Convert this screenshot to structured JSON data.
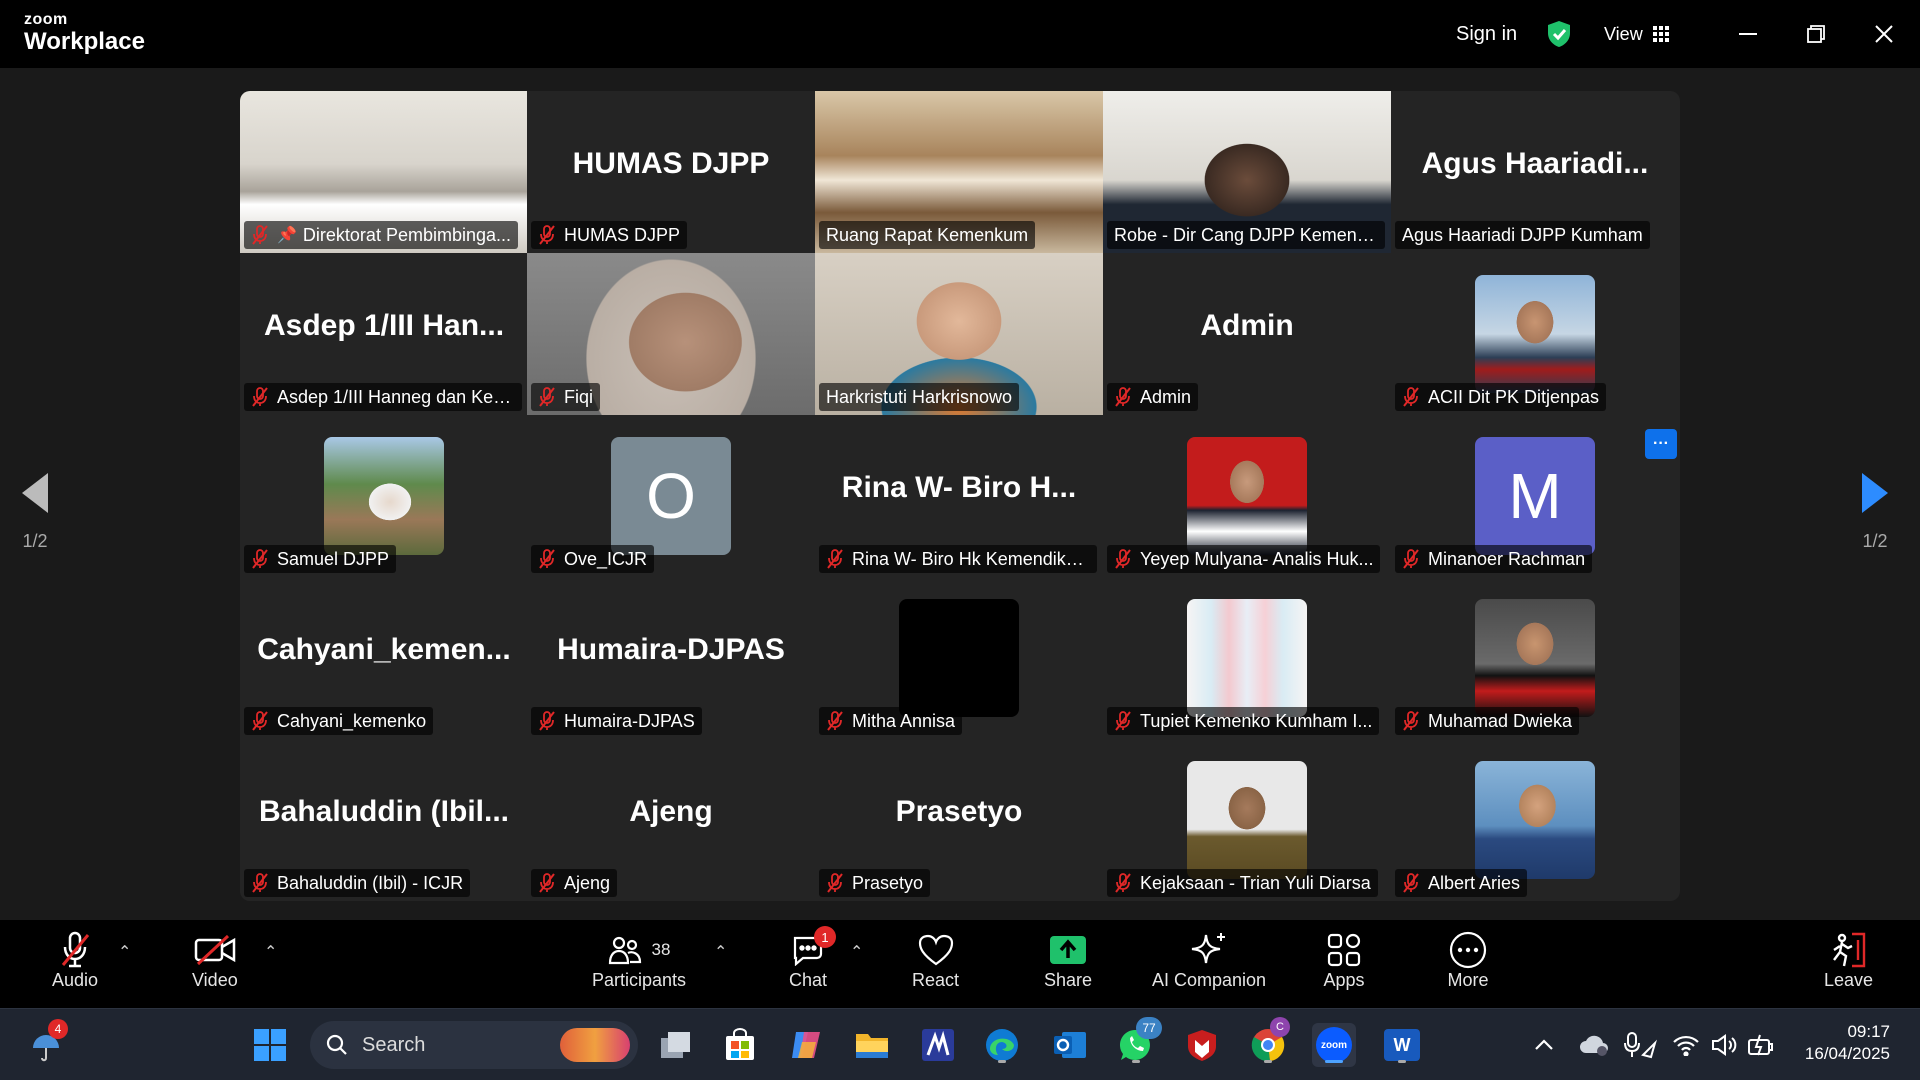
{
  "titlebar": {
    "brand_top": "zoom",
    "brand_bottom": "Workplace",
    "sign_in": "Sign in",
    "view_label": "View",
    "colors": {
      "shield": "#1fc16b"
    }
  },
  "pager": {
    "left": "1/2",
    "right": "1/2"
  },
  "tiles": [
    {
      "label": "Direktorat Pembimbinga...",
      "pinned": true,
      "muted": true,
      "type": "video",
      "scene": "meeting-room"
    },
    {
      "label": "HUMAS DJPP",
      "muted": true,
      "type": "name",
      "big_name": "HUMAS DJPP"
    },
    {
      "label": "Ruang Rapat Kemenkum",
      "muted": false,
      "type": "video",
      "scene": "conference-room"
    },
    {
      "label": "Robe - Dir Cang DJPP Kemenku...",
      "muted": false,
      "type": "video",
      "scene": "office-person",
      "active": true
    },
    {
      "label": "Agus Haariadi DJPP Kumham",
      "muted": false,
      "type": "name",
      "big_name": "Agus  Haariadi..."
    },
    {
      "label": "Asdep 1/III Hanneg dan Kes...",
      "muted": true,
      "type": "name",
      "big_name": "Asdep  1/III  Han..."
    },
    {
      "label": "Fiqi",
      "muted": true,
      "type": "video",
      "scene": "webcam-woman-hijab"
    },
    {
      "label": "Harkristuti Harkrisnowo",
      "muted": false,
      "type": "video",
      "scene": "webcam-woman"
    },
    {
      "label": "Admin",
      "muted": true,
      "type": "name",
      "big_name": "Admin"
    },
    {
      "label": "ACII Dit PK Ditjenpas",
      "muted": true,
      "type": "avatar",
      "avatar": "photo-man-suit"
    },
    {
      "label": "Samuel DJPP",
      "muted": true,
      "type": "avatar",
      "avatar": "photo-outdoor"
    },
    {
      "label": "Ove_ICJR",
      "muted": true,
      "type": "avatar",
      "initial": "O",
      "avatar_color": "#7a8a94"
    },
    {
      "label": "Rina W- Biro Hk Kemendikd...",
      "muted": true,
      "type": "name",
      "big_name": "Rina W-  Biro H..."
    },
    {
      "label": "Yeyep Mulyana- Analis Huk...",
      "muted": true,
      "type": "avatar",
      "avatar": "photo-red-bg"
    },
    {
      "label": "Minanoer Rachman",
      "muted": true,
      "type": "avatar",
      "initial": "M",
      "avatar_color": "#5b5fc7"
    },
    {
      "label": "Cahyani_kemenko",
      "muted": true,
      "type": "name",
      "big_name": "Cahyani_kemen..."
    },
    {
      "label": "Humaira-DJPAS",
      "muted": true,
      "type": "name",
      "big_name": "Humaira-DJPAS"
    },
    {
      "label": "Mitha Annisa",
      "muted": true,
      "type": "avatar",
      "avatar": "photo-black"
    },
    {
      "label": "Tupiet Kemenko Kumham I...",
      "muted": true,
      "type": "avatar",
      "avatar": "photo-group"
    },
    {
      "label": "Muhamad Dwieka",
      "muted": true,
      "type": "avatar",
      "avatar": "photo-man-suit-dark"
    },
    {
      "label": "Bahaluddin (Ibil) - ICJR",
      "muted": true,
      "type": "name",
      "big_name": "Bahaluddin  (Ibil..."
    },
    {
      "label": "Ajeng",
      "muted": true,
      "type": "name",
      "big_name": "Ajeng"
    },
    {
      "label": "Prasetyo",
      "muted": true,
      "type": "name",
      "big_name": "Prasetyo"
    },
    {
      "label": "Kejaksaan - Trian Yuli Diarsa",
      "muted": true,
      "type": "avatar",
      "avatar": "photo-uniform"
    },
    {
      "label": "Albert Aries",
      "muted": true,
      "type": "avatar",
      "avatar": "photo-man-blue"
    }
  ],
  "toolbar": {
    "audio": "Audio",
    "video": "Video",
    "participants": "Participants",
    "participants_count": "38",
    "chat": "Chat",
    "chat_badge": "1",
    "react": "React",
    "share": "Share",
    "ai_companion": "AI Companion",
    "apps": "Apps",
    "more": "More",
    "leave": "Leave",
    "colors": {
      "share": "#1fc16b",
      "leave": "#e02828",
      "muted": "#e02828"
    }
  },
  "taskbar": {
    "search_placeholder": "Search",
    "weather_badge": "4",
    "whatsapp_badge": "77",
    "chrome_badge": "C",
    "zoom_icon_text": "zoom",
    "word_icon_text": "W",
    "time": "09:17",
    "date": "16/04/2025"
  }
}
